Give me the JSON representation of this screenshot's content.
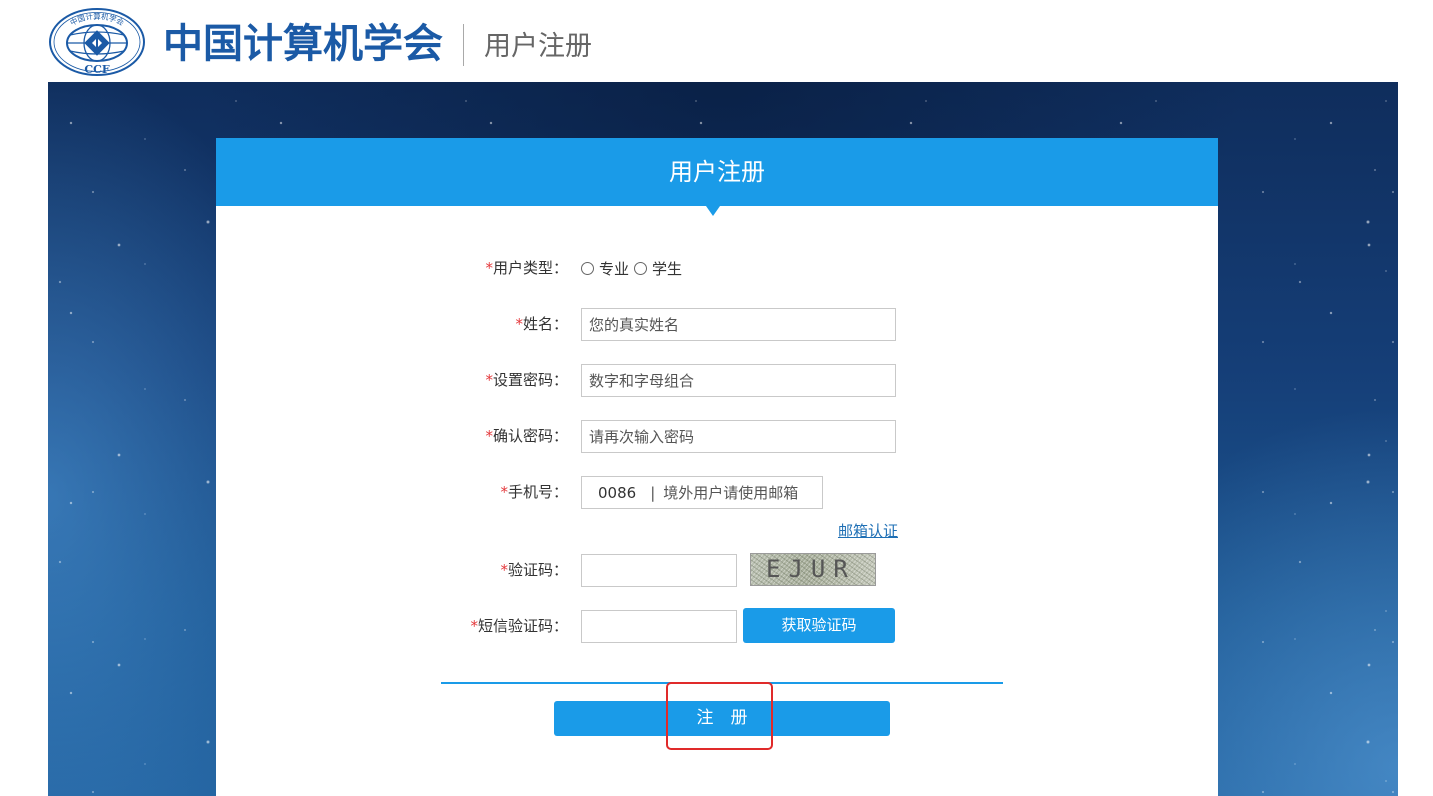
{
  "header": {
    "logo": {
      "lettering": "CCF",
      "arc_text": "中国计算机学会"
    },
    "org_name": "中国计算机学会",
    "page_name": "用户注册"
  },
  "card": {
    "title": "用户注册"
  },
  "form": {
    "required_mark": "*",
    "user_type": {
      "label": "用户类型：",
      "options": [
        {
          "label": "专业",
          "selected": false
        },
        {
          "label": "学生",
          "selected": false
        }
      ]
    },
    "name": {
      "label": "姓名：",
      "value": "",
      "placeholder": "您的真实姓名"
    },
    "password": {
      "label": "设置密码：",
      "value": "",
      "placeholder": "数字和字母组合"
    },
    "confirm_password": {
      "label": "确认密码：",
      "value": "",
      "placeholder": "请再次输入密码"
    },
    "phone": {
      "label": "手机号：",
      "country_code": "0086",
      "separator": "|",
      "value": "",
      "placeholder": "境外用户请使用邮箱"
    },
    "email_auth_link": "邮箱认证",
    "captcha": {
      "label": "验证码：",
      "value": "",
      "image_text": "EJUR"
    },
    "sms_code": {
      "label": "短信验证码：",
      "value": "",
      "button_label": "获取验证码"
    },
    "submit_label": "注　册"
  },
  "icons": [
    "ccf-logo-icon",
    "radio-icon",
    "dropdown-notch-icon"
  ],
  "colors": {
    "accent": "#1a9be8",
    "brand": "#1b5aa6",
    "required": "#e4393c",
    "link": "#1e6fb5",
    "annotation": "#e02a2a"
  }
}
